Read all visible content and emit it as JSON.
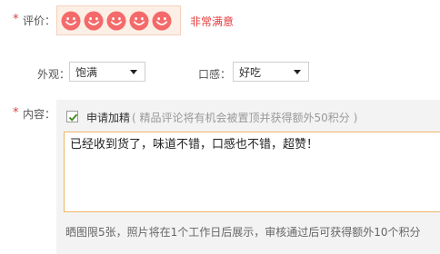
{
  "rating": {
    "required_mark": "*",
    "label": "评价：",
    "stars": 5,
    "max": 5,
    "text": "非常满意",
    "icon": "smiley-face-icon",
    "color": "#f46a6a"
  },
  "appearance": {
    "label": "外观：",
    "selected": "饱满"
  },
  "taste": {
    "label": "口感：",
    "selected": "好吃"
  },
  "content": {
    "required_mark": "*",
    "label": "内容：",
    "apply_checked": true,
    "apply_label": "申请加精",
    "apply_hint": "( 精品评论将有机会被置顶并获得额外50积分 )",
    "text": "已经收到货了，味道不错，口感也不错，超赞！",
    "photo_note": "晒图限5张，照片将在1个工作日后展示，审核通过后可获得额外10个积分"
  },
  "colors": {
    "accent_red": "#e4393c",
    "textarea_border": "#f0b46a",
    "checkbox_check": "#4a8f2a"
  }
}
